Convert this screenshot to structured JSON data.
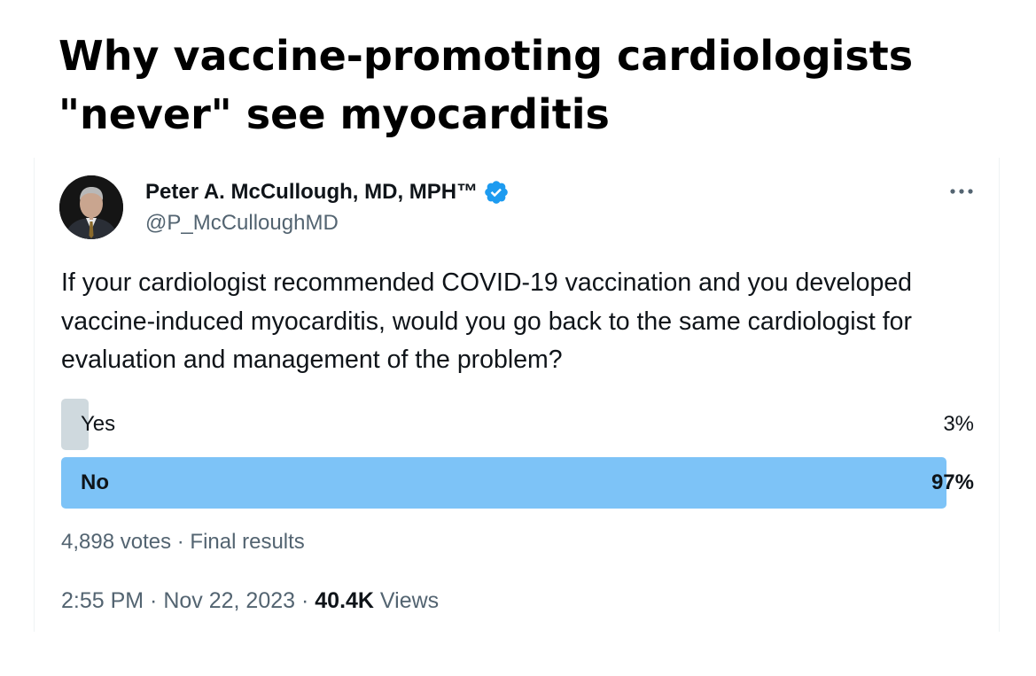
{
  "headline": {
    "line1": "Why vaccine-promoting cardiologists",
    "line2": "\"never\" see myocarditis"
  },
  "tweet": {
    "author_name": "Peter A. McCullough, MD, MPH™",
    "author_handle": "@P_McCulloughMD",
    "verified": true,
    "text": "If your cardiologist recommended COVID-19 vaccination and you developed vaccine-induced myocarditis, would you go back to the same cardiologist for evaluation and management of the problem?",
    "poll": {
      "options": [
        {
          "label": "Yes",
          "percent_text": "3%",
          "fraction": 0.03
        },
        {
          "label": "No",
          "percent_text": "97%",
          "fraction": 0.97
        }
      ],
      "votes_text": "4,898 votes",
      "separator": " · ",
      "status_text": "Final results"
    },
    "time": "2:55 PM",
    "date": "Nov 22, 2023",
    "dot": " · ",
    "views_count": "40.4K",
    "views_label": " Views"
  },
  "colors": {
    "accent": "#1d9bf0",
    "winner_bar": "#7dc3f7",
    "loser_bar": "#cfd9de",
    "muted_text": "#536471"
  },
  "icons": {
    "verified": "verified-badge-icon",
    "more": "more-horizontal-icon"
  }
}
